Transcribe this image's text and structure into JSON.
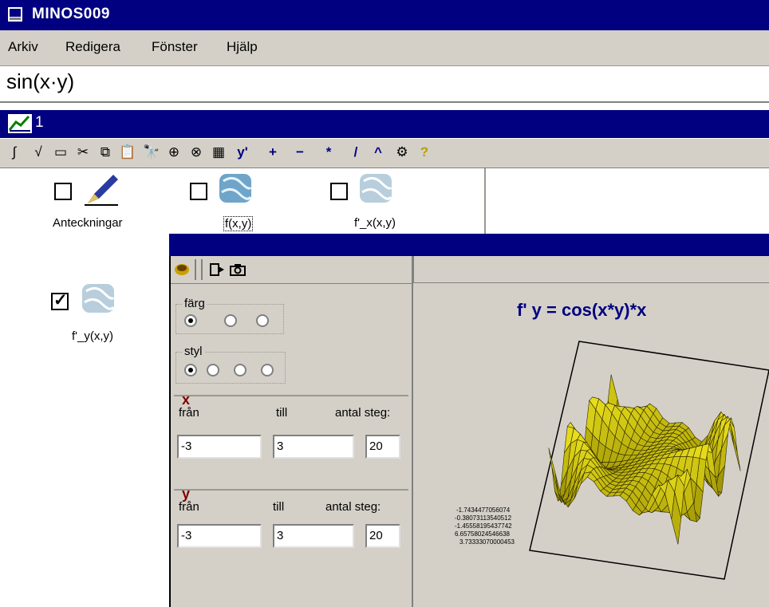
{
  "app": {
    "title": "MINOS009"
  },
  "menu": {
    "items": [
      "Arkiv",
      "Redigera",
      "Fönster",
      "Hjälp"
    ]
  },
  "formula": {
    "text": "sin(x·y)"
  },
  "child_window": {
    "title": "1"
  },
  "toolbar": {
    "symbols": [
      "∫",
      "√",
      "▭",
      "✂",
      "⧉",
      "📋",
      "🔭",
      "⊕",
      "⊗",
      "▦",
      "y'",
      "+",
      "−",
      "*",
      "/",
      "^",
      "⚙",
      "?"
    ]
  },
  "objects": [
    {
      "label": "Anteckningar",
      "checked": false,
      "icon": "pen-icon"
    },
    {
      "label": "f(x,y)",
      "checked": false,
      "icon": "surface-icon"
    },
    {
      "label": "f'_x(x,y)",
      "checked": false,
      "icon": "surface-icon"
    },
    {
      "label": "f'_y(x,y)",
      "checked": true,
      "icon": "surface-icon"
    }
  ],
  "plot": {
    "title": "f' y = cos(x*y)*x",
    "farg": {
      "legend": "färg",
      "selected": 0,
      "count": 3
    },
    "styl": {
      "legend": "styl",
      "selected": 0,
      "count": 4
    },
    "x": {
      "letter": "x",
      "from_label": "från",
      "to_label": "till",
      "steps_label": "antal steg:",
      "from": "-3",
      "to": "3",
      "steps": "20"
    },
    "y": {
      "letter": "y",
      "from_label": "från",
      "to_label": "till",
      "steps_label": "antal steg:",
      "from": "-3",
      "to": "3",
      "steps": "20"
    },
    "axis_values": [
      "-1.7434477056074",
      "-0.38073113540512",
      "-1.45558195437742",
      "6.65758024546638",
      "3.73333070000453"
    ],
    "surface_color": "#c8c000"
  }
}
